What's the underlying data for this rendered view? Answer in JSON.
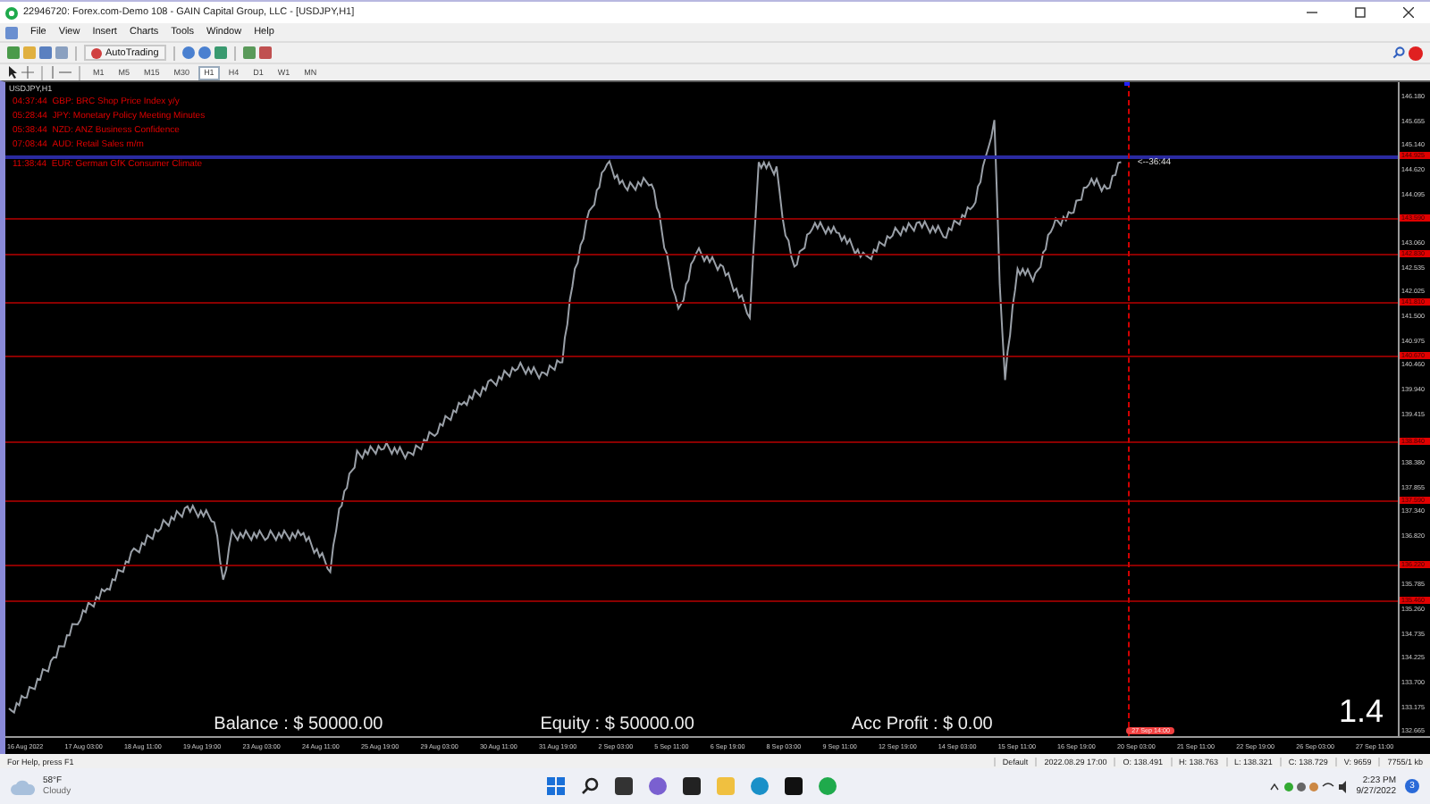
{
  "window": {
    "title": "22946720: Forex.com-Demo 108 - GAIN Capital Group, LLC - [USDJPY,H1]"
  },
  "menu": [
    {
      "label": "File"
    },
    {
      "label": "View"
    },
    {
      "label": "Insert"
    },
    {
      "label": "Charts"
    },
    {
      "label": "Tools"
    },
    {
      "label": "Window"
    },
    {
      "label": "Help"
    }
  ],
  "toolbar": {
    "autotrading": "AutoTrading",
    "timeframes": [
      {
        "label": "M1",
        "selected": false
      },
      {
        "label": "M5",
        "selected": false
      },
      {
        "label": "M15",
        "selected": false
      },
      {
        "label": "M30",
        "selected": false
      },
      {
        "label": "H1",
        "selected": true
      },
      {
        "label": "H4",
        "selected": false
      },
      {
        "label": "D1",
        "selected": false
      },
      {
        "label": "W1",
        "selected": false
      },
      {
        "label": "MN",
        "selected": false
      }
    ]
  },
  "chart": {
    "tab": "USDJPY,H1",
    "news": [
      {
        "time": "04:37:44",
        "text": "GBP: BRC Shop Price Index y/y"
      },
      {
        "time": "05:28:44",
        "text": "JPY: Monetary Policy Meeting Minutes"
      },
      {
        "time": "05:38:44",
        "text": "NZD: ANZ Business Confidence"
      },
      {
        "time": "07:08:44",
        "text": "AUD: Retail Sales m/m"
      },
      {
        "time": "11:38:44",
        "text": "EUR: German GfK Consumer Climate"
      }
    ],
    "price_ticks": [
      "146.180",
      "145.655",
      "145.140",
      "144.620",
      "144.095",
      "143.060",
      "142.535",
      "142.025",
      "141.500",
      "140.975",
      "140.460",
      "139.940",
      "139.415",
      "138.380",
      "137.855",
      "137.340",
      "136.820",
      "135.785",
      "135.260",
      "134.735",
      "134.225",
      "133.700",
      "133.175",
      "132.665"
    ],
    "levels": [
      {
        "kind": "bid",
        "price": "144.925"
      },
      {
        "kind": "level",
        "price": "143.590"
      },
      {
        "kind": "level",
        "price": "142.830"
      },
      {
        "kind": "level",
        "price": "141.810"
      },
      {
        "kind": "level",
        "price": "140.670"
      },
      {
        "kind": "level",
        "price": "138.840"
      },
      {
        "kind": "level",
        "price": "137.590"
      },
      {
        "kind": "level",
        "price": "136.220"
      },
      {
        "kind": "level",
        "price": "135.460"
      }
    ],
    "countdown": "<--36:44",
    "cursor_time": "27 Sep 14:00",
    "time_ticks": [
      "16 Aug 2022",
      "17 Aug 03:00",
      "18 Aug 11:00",
      "19 Aug 19:00",
      "23 Aug 03:00",
      "24 Aug 11:00",
      "25 Aug 19:00",
      "29 Aug 03:00",
      "30 Aug 11:00",
      "31 Aug 19:00",
      "2 Sep 03:00",
      "5 Sep 11:00",
      "6 Sep 19:00",
      "8 Sep 03:00",
      "9 Sep 11:00",
      "12 Sep 19:00",
      "14 Sep 03:00",
      "15 Sep 11:00",
      "16 Sep 19:00",
      "20 Sep 03:00",
      "21 Sep 11:00",
      "22 Sep 19:00",
      "26 Sep 03:00",
      "27 Sep 11:00"
    ],
    "account": [
      "Balance : $ 50000.00",
      "Equity : $ 50000.00",
      "Acc Profit : $ 0.00"
    ],
    "spread": "1.4"
  },
  "status_bar": [
    "For Help, press F1",
    "Default",
    "2022.08.29 17:00",
    "O: 138.491",
    "H: 138.763",
    "L: 138.321",
    "C: 138.729",
    "V: 9659",
    "7755/1 kb"
  ],
  "taskbar": {
    "temperature": "58°F",
    "condition": "Cloudy",
    "time": "2:23 PM",
    "date": "9/27/2022",
    "notifications": "3"
  }
}
